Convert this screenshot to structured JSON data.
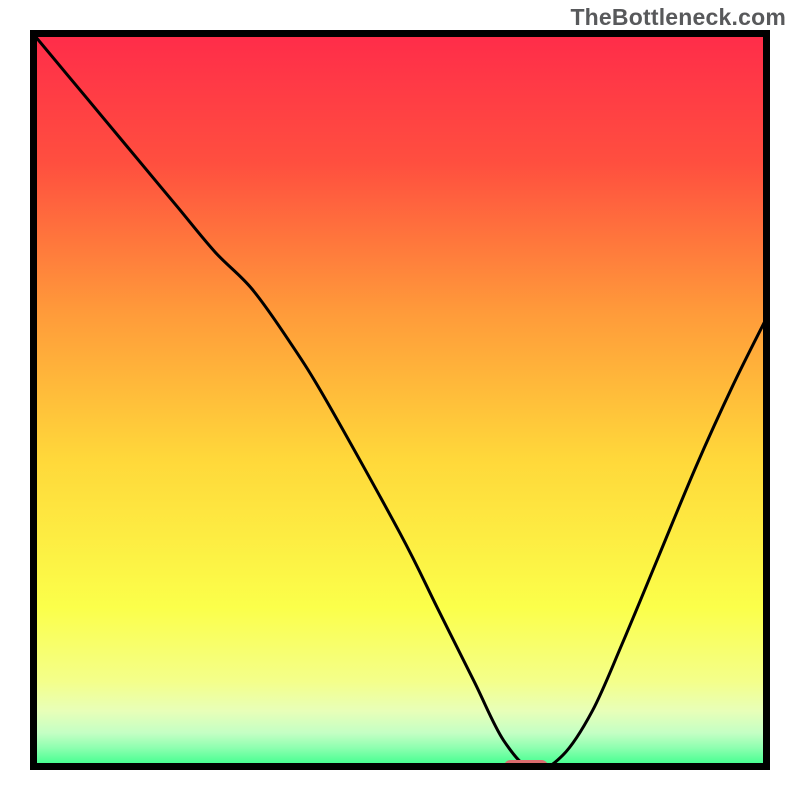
{
  "attribution": "TheBottleneck.com",
  "colors": {
    "gradient_top": "#ff2b4a",
    "gradient_upper_mid": "#ff7a3a",
    "gradient_mid": "#ffd83a",
    "gradient_lower_mid": "#f6ff66",
    "gradient_pale_green": "#c9ffb0",
    "gradient_bottom": "#2bff85",
    "curve": "#000000",
    "marker": "#da6b6e",
    "border": "#000000"
  },
  "chart_data": {
    "type": "line",
    "title": "",
    "xlabel": "",
    "ylabel": "",
    "xlim": [
      0,
      100
    ],
    "ylim": [
      0,
      100
    ],
    "series": [
      {
        "name": "bottleneck-curve",
        "x": [
          0,
          5,
          10,
          15,
          20,
          25,
          30,
          35,
          40,
          50,
          55,
          60,
          64,
          68,
          72,
          76,
          80,
          85,
          90,
          95,
          100
        ],
        "values": [
          100,
          94,
          88,
          82,
          76,
          70,
          65,
          58,
          50,
          32,
          22,
          12,
          4,
          0,
          2,
          8,
          17,
          29,
          41,
          52,
          62
        ]
      }
    ],
    "annotations": [
      {
        "name": "optimal-marker",
        "x_center": 67,
        "y": 0.5,
        "width_pct": 6.0,
        "height_pct": 1.8
      }
    ],
    "legend": []
  }
}
